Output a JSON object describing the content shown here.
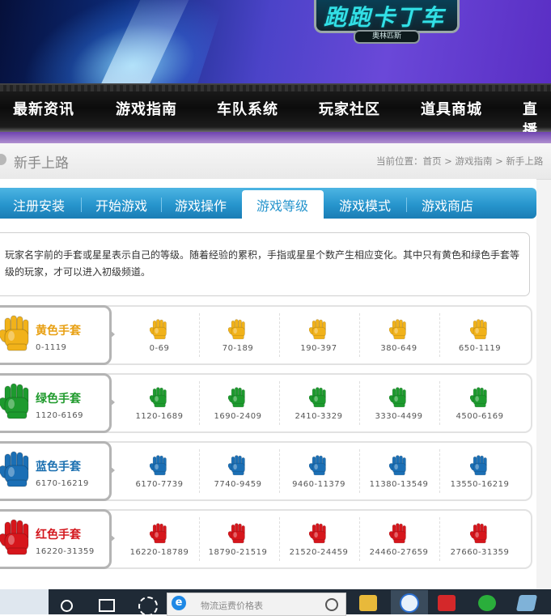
{
  "banner": {
    "logo_text": "跑跑卡丁车",
    "logo_sub": "奥林匹斯"
  },
  "nav": {
    "items": [
      "最新资讯",
      "游戏指南",
      "车队系统",
      "玩家社区",
      "道具商城",
      "直播"
    ]
  },
  "section": {
    "title": "新手上路",
    "breadcrumb": "当前位置：首页 > 游戏指南 > 新手上路"
  },
  "tabs": {
    "items": [
      "注册安装",
      "开始游戏",
      "游戏操作",
      "游戏等级",
      "游戏模式",
      "游戏商店"
    ],
    "active": "游戏等级"
  },
  "intro": {
    "text": "玩家名字前的手套或星星表示自己的等级。随着经验的累积，手指或星星个数产生相应变化。其中只有黄色和绿色手套等级的玩家，才可以进入初级频道。"
  },
  "levels": [
    {
      "name": "黄色手套",
      "range": "0-1119",
      "color": "#f1b21a",
      "label_color": "#e8a013",
      "steps": [
        "0-69",
        "70-189",
        "190-397",
        "380-649",
        "650-1119"
      ]
    },
    {
      "name": "绿色手套",
      "range": "1120-6169",
      "color": "#1d9a2e",
      "label_color": "#1f9a2c",
      "steps": [
        "1120-1689",
        "1690-2409",
        "2410-3329",
        "3330-4499",
        "4500-6169"
      ]
    },
    {
      "name": "蓝色手套",
      "range": "6170-16219",
      "color": "#1b6fb5",
      "label_color": "#1a6fb0",
      "steps": [
        "6170-7739",
        "7740-9459",
        "9460-11379",
        "11380-13549",
        "13550-16219"
      ]
    },
    {
      "name": "红色手套",
      "range": "16220-31359",
      "color": "#d6161c",
      "label_color": "#d3161c",
      "steps": [
        "16220-18789",
        "18790-21519",
        "21520-24459",
        "24460-27659",
        "27660-31359"
      ]
    }
  ],
  "taskbar": {
    "search_placeholder": "物流运费价格表",
    "icons": [
      "cortana-icon",
      "task-view-icon",
      "pinwheel-icon",
      "ie-icon",
      "file-explorer-icon",
      "sogou-icon",
      "wps-icon",
      "wechat-icon",
      "tablet-icon"
    ]
  }
}
